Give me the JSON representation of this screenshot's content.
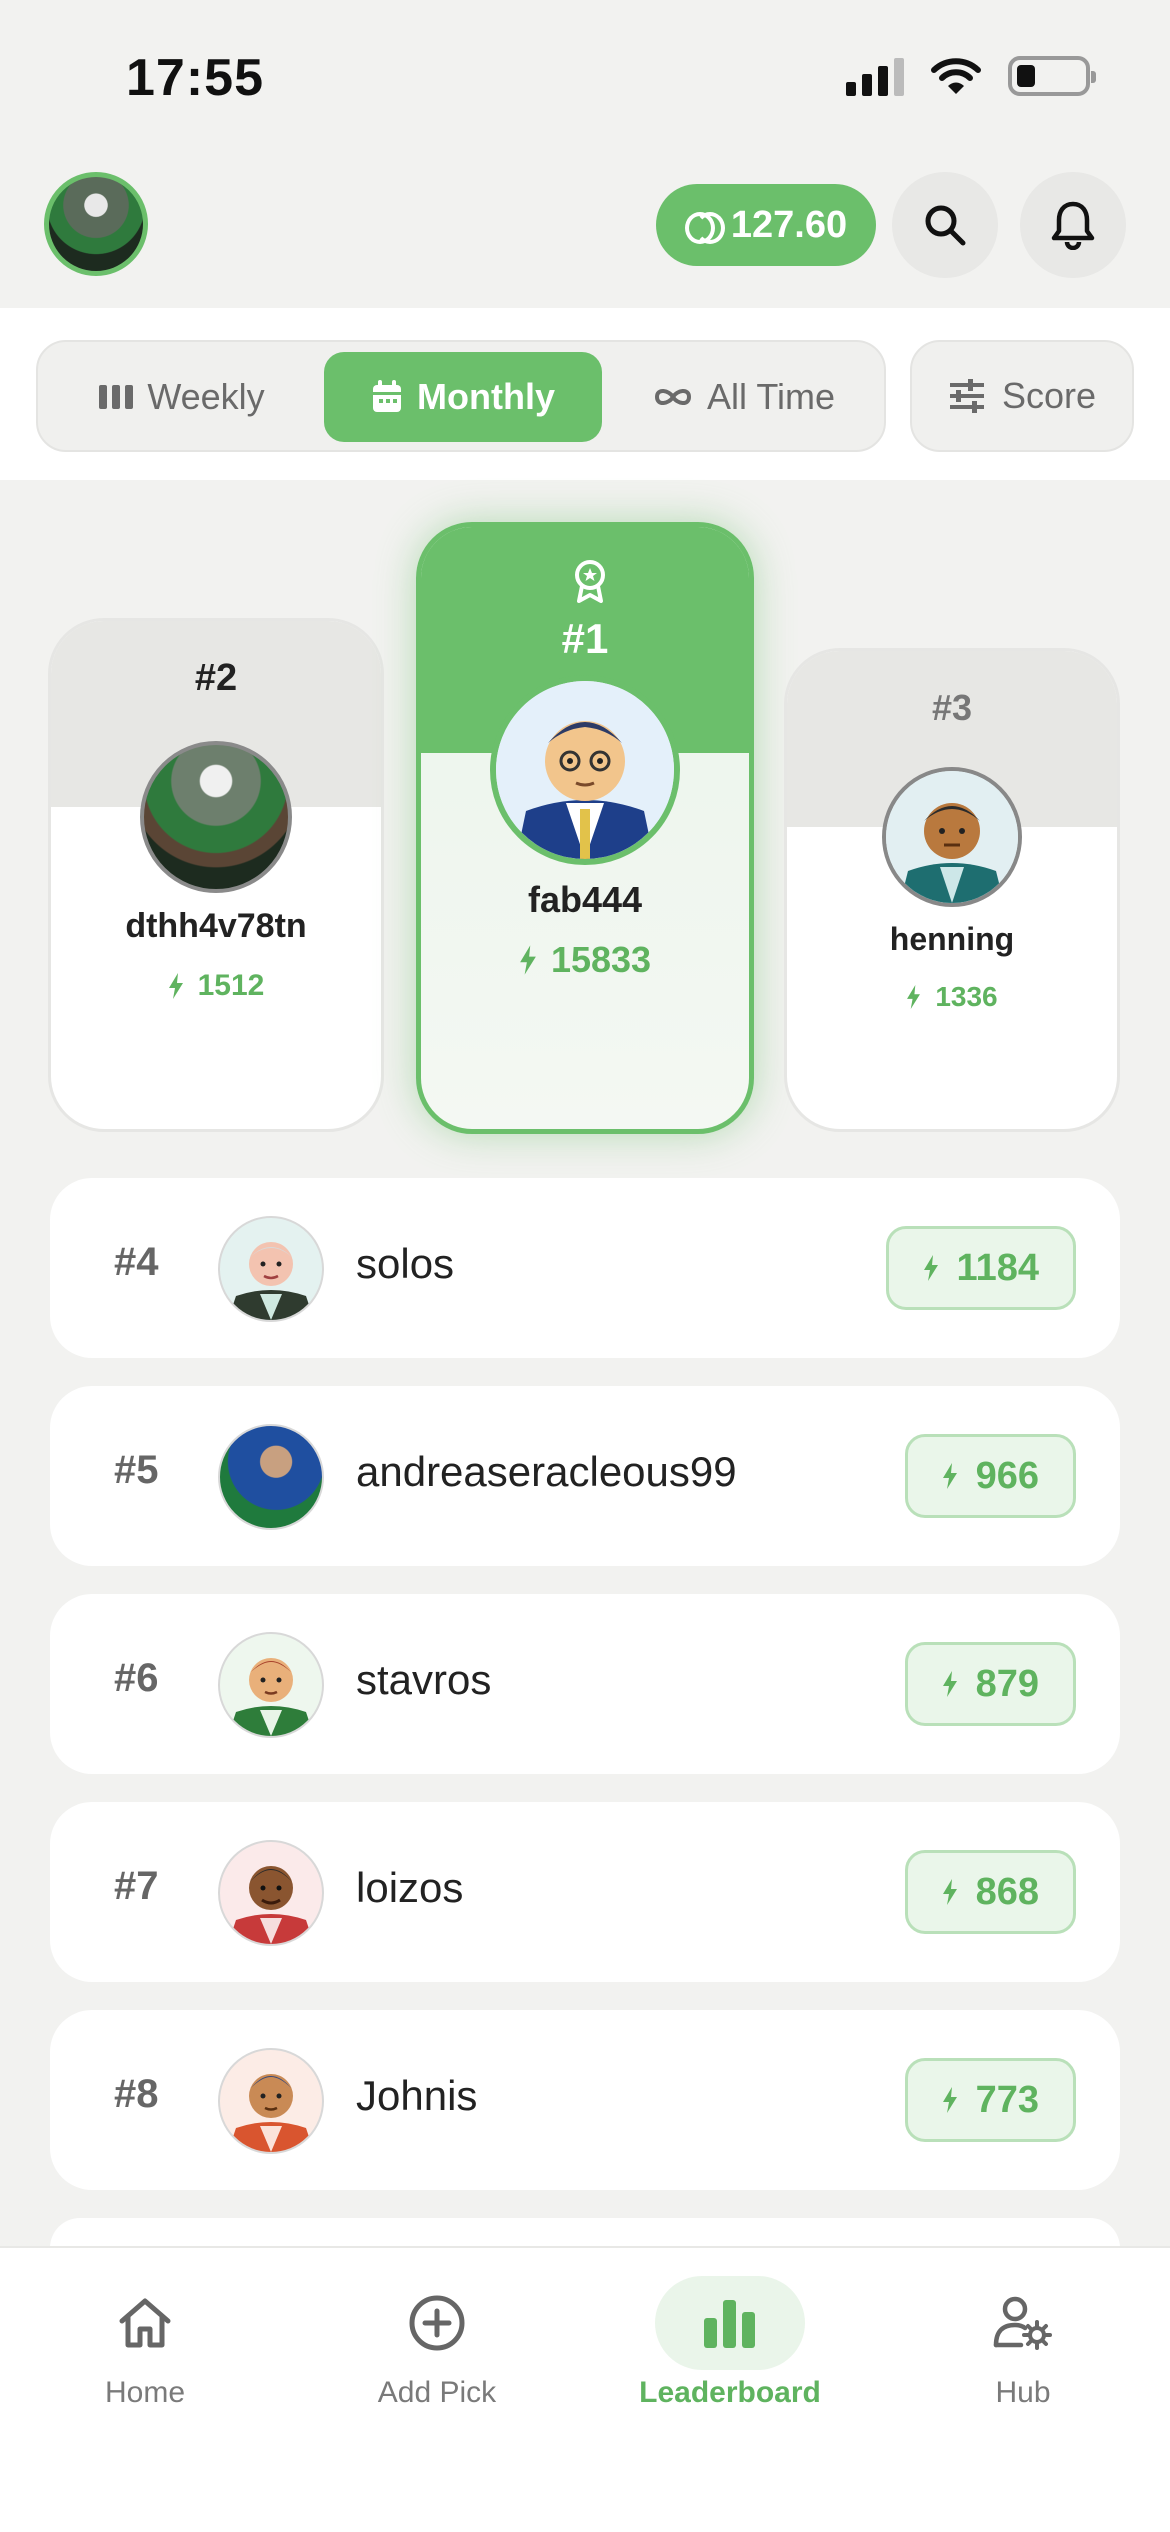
{
  "status": {
    "time": "17:55"
  },
  "header": {
    "balance": "127.60"
  },
  "filters": {
    "weekly": "Weekly",
    "monthly": "Monthly",
    "all_time": "All Time",
    "score": "Score",
    "active": "Monthly"
  },
  "podium": {
    "first": {
      "rank": "#1",
      "name": "fab444",
      "points": "15833"
    },
    "second": {
      "rank": "#2",
      "name": "dthh4v78tn",
      "points": "1512"
    },
    "third": {
      "rank": "#3",
      "name": "henning",
      "points": "1336"
    }
  },
  "list": [
    {
      "rank": "#4",
      "name": "solos",
      "points": "1184"
    },
    {
      "rank": "#5",
      "name": "andreaseracleous99",
      "points": "966"
    },
    {
      "rank": "#6",
      "name": "stavros",
      "points": "879"
    },
    {
      "rank": "#7",
      "name": "loizos",
      "points": "868"
    },
    {
      "rank": "#8",
      "name": "Johnis",
      "points": "773"
    }
  ],
  "nav": {
    "home": "Home",
    "add_pick": "Add Pick",
    "leaderboard": "Leaderboard",
    "hub": "Hub",
    "active": "Leaderboard"
  },
  "colors": {
    "accent": "#6bbf6b",
    "accent_light": "#eaf6ea",
    "background": "#f2f2f0"
  }
}
